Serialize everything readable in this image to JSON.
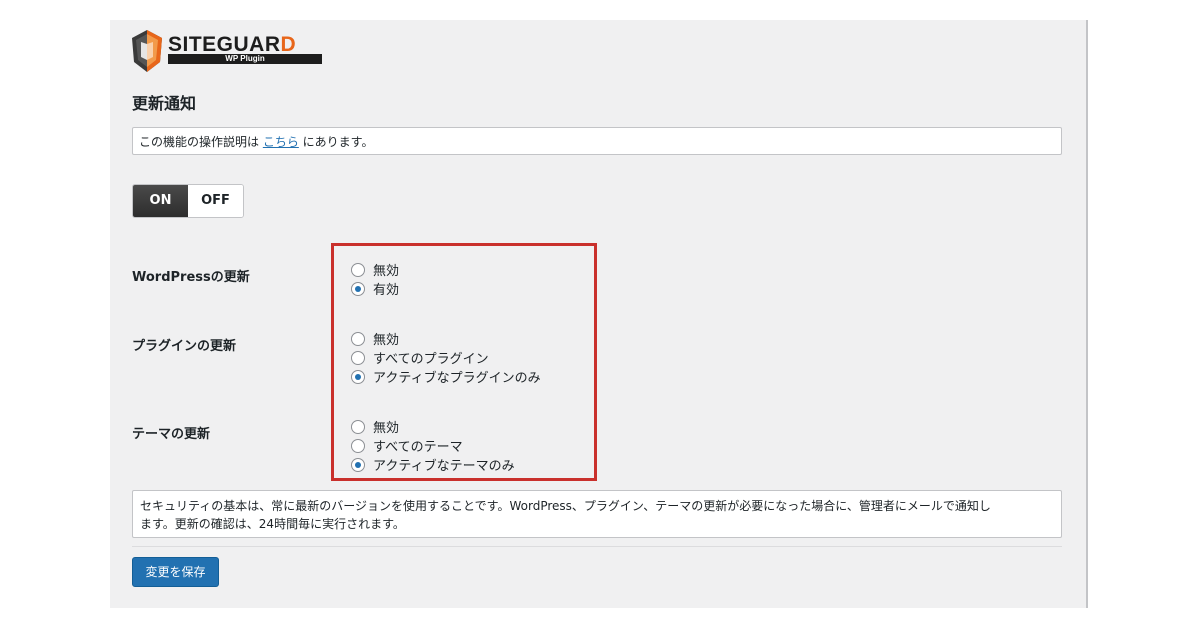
{
  "brand": {
    "name_main": "SITEGUAR",
    "name_accent": "D",
    "sub": "WP Plugin",
    "accent_color": "#e8661a"
  },
  "page": {
    "title": "更新通知"
  },
  "note": {
    "before": "この機能の操作説明は ",
    "link": "こちら",
    "after": " にあります。"
  },
  "toggle": {
    "on_label": "ON",
    "off_label": "OFF",
    "active": "ON"
  },
  "sections": [
    {
      "label": "WordPressの更新",
      "options": [
        {
          "label": "無効",
          "checked": false
        },
        {
          "label": "有効",
          "checked": true
        }
      ]
    },
    {
      "label": "プラグインの更新",
      "options": [
        {
          "label": "無効",
          "checked": false
        },
        {
          "label": "すべてのプラグイン",
          "checked": false
        },
        {
          "label": "アクティブなプラグインのみ",
          "checked": true
        }
      ]
    },
    {
      "label": "テーマの更新",
      "options": [
        {
          "label": "無効",
          "checked": false
        },
        {
          "label": "すべてのテーマ",
          "checked": false
        },
        {
          "label": "アクティブなテーマのみ",
          "checked": true
        }
      ]
    }
  ],
  "info": {
    "line1": "セキュリティの基本は、常に最新のバージョンを使用することです。WordPress、プラグイン、テーマの更新が必要になった場合に、管理者にメールで通知し",
    "line2": "ます。更新の確認は、24時間毎に実行されます。"
  },
  "actions": {
    "save_label": "変更を保存"
  },
  "colors": {
    "primary": "#2271b1",
    "highlight_border": "#c9302c"
  }
}
